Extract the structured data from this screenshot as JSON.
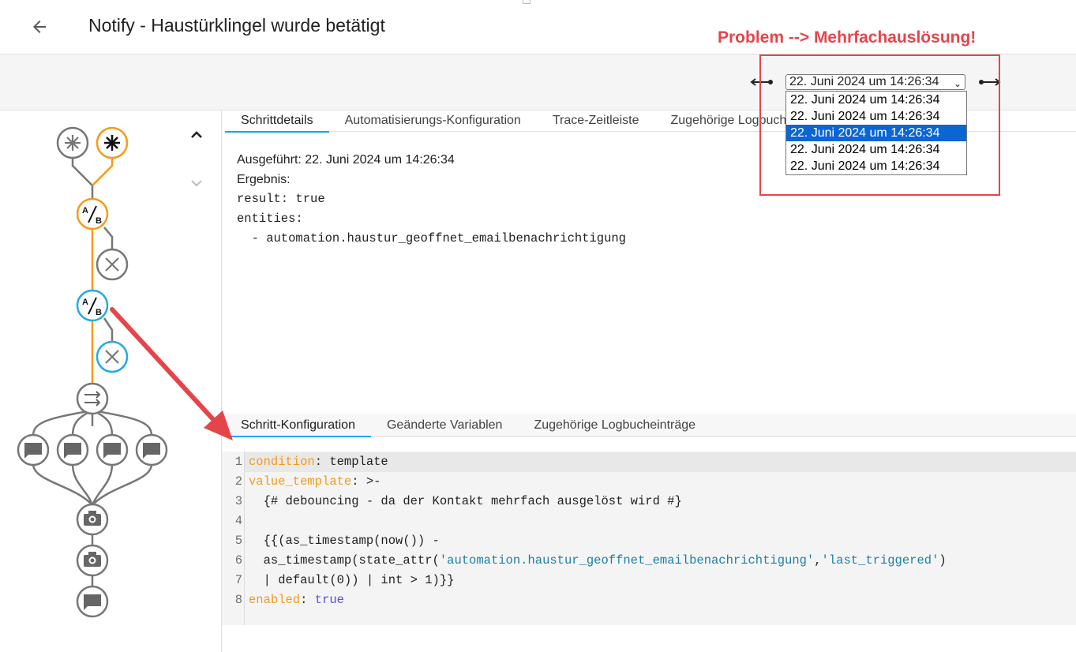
{
  "header": {
    "title": "Notify - Haustürklingel wurde betätigt",
    "back_icon": "arrow-left-icon"
  },
  "annotation": {
    "text": "Problem --> Mehrfachauslösung!",
    "color": "#e5454a"
  },
  "run_selector": {
    "selected": "22. Juni 2024 um 14:26:34",
    "options": [
      "22. Juni 2024 um 14:26:34",
      "22. Juni 2024 um 14:26:34",
      "22. Juni 2024 um 14:26:34",
      "22. Juni 2024 um 14:26:34",
      "22. Juni 2024 um 14:26:34"
    ],
    "highlighted_index": 2,
    "highlight_color": "#0b65d3"
  },
  "top_tabs": [
    "Schrittdetails",
    "Automatisierungs-Konfiguration",
    "Trace-Zeitleiste",
    "Zugehörige Logbucheinträge"
  ],
  "details": {
    "executed": "Ausgeführt: 22. Juni 2024 um 14:26:34",
    "result_label": "Ergebnis:",
    "result_line": "result: true",
    "entities_label": "entities:",
    "entity": "  - automation.haustur_geoffnet_emailbenachrichtigung"
  },
  "bottom_tabs": [
    "Schritt-Konfiguration",
    "Geänderte Variablen",
    "Zugehörige Logbucheinträge"
  ],
  "code": {
    "line_numbers": [
      "1",
      "2",
      "3",
      "4",
      "5",
      "6",
      "7",
      "8"
    ],
    "l1_key": "condition",
    "l1_rest": ": template",
    "l2_key": "value_template",
    "l2_rest": ": >-",
    "l3": "  {# debouncing - da der Kontakt mehrfach ausgelöst wird #}",
    "l4": "",
    "l5": "  {{(as_timestamp(now()) -",
    "l6_a": "  as_timestamp(state_attr(",
    "l6_s1": "'automation.haustur_geoffnet_emailbenachrichtigung'",
    "l6_c": ",",
    "l6_s2": "'last_triggered'",
    "l6_b": ")",
    "l7": "  | default(0)) | int > 1)}}",
    "l8_key": "enabled",
    "l8_sep": ": ",
    "l8_val": "true"
  },
  "graph": {
    "accent_color": "#f59a1b",
    "selected_color": "#23a9e8",
    "node_icons": [
      "trigger-icon",
      "trigger-icon",
      "condition-ab-icon",
      "disabled-x-icon",
      "condition-ab-icon",
      "disabled-x-icon",
      "choose-icon",
      "message-icon",
      "message-icon",
      "message-icon",
      "message-icon",
      "camera-icon",
      "camera-icon",
      "message-icon"
    ]
  },
  "colors": {
    "tab_indicator": "#03a9f4",
    "yaml_key": "#ef9a1f",
    "yaml_string": "#1e7fa6",
    "yaml_bool": "#5b4ddc"
  }
}
